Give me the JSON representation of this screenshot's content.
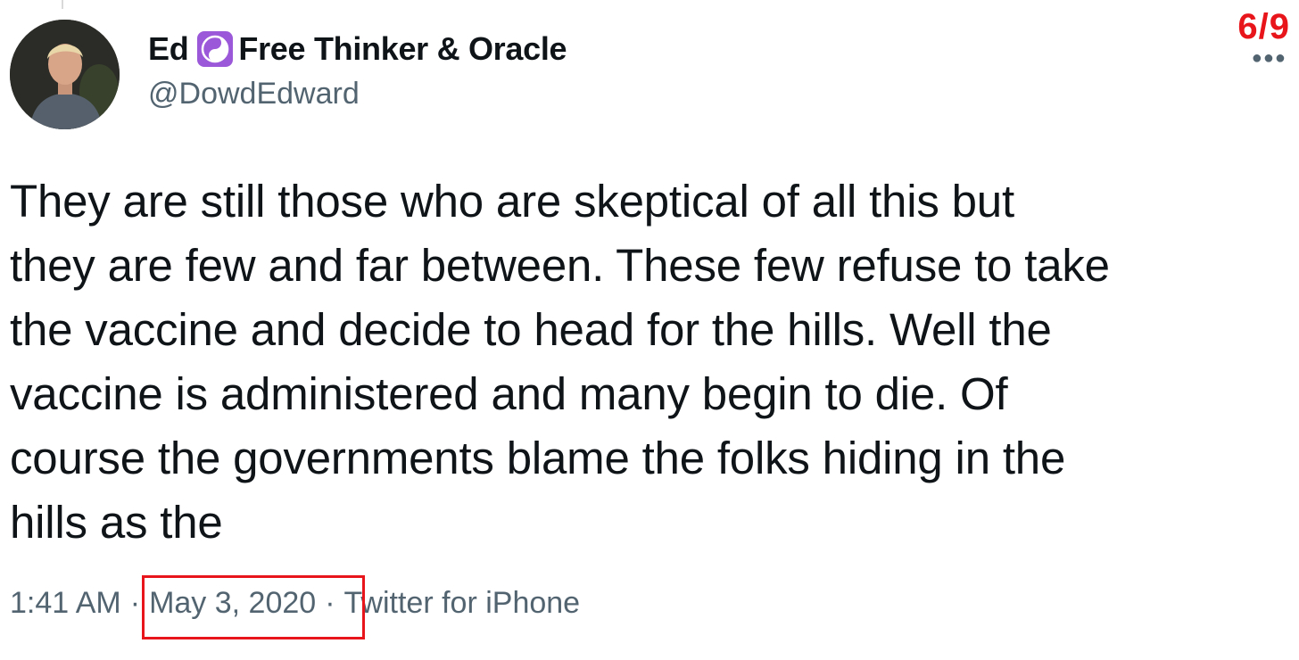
{
  "tweet": {
    "author": {
      "name_first": "Ed",
      "name_rest": "Free Thinker & Oracle",
      "badge_icon": "yin-yang-icon",
      "handle": "@DowdEdward"
    },
    "thread_counter": "6/9",
    "more_icon": "more-options-icon",
    "text": "They are still those who are skeptical of all this but\nthey are few and far between. These few refuse to take\nthe vaccine and decide to head for the hills. Well the\nvaccine is administered and many begin to die. Of\ncourse the governments blame the folks hiding in the\nhills as the",
    "time": "1:41 AM",
    "separator": "·",
    "date": "May 3, 2020",
    "source": "Twitter for iPhone"
  },
  "colors": {
    "highlight_red": "#e8161b",
    "text_primary": "#0f1419",
    "text_secondary": "#536471",
    "badge_purple": "#9b59d9"
  }
}
